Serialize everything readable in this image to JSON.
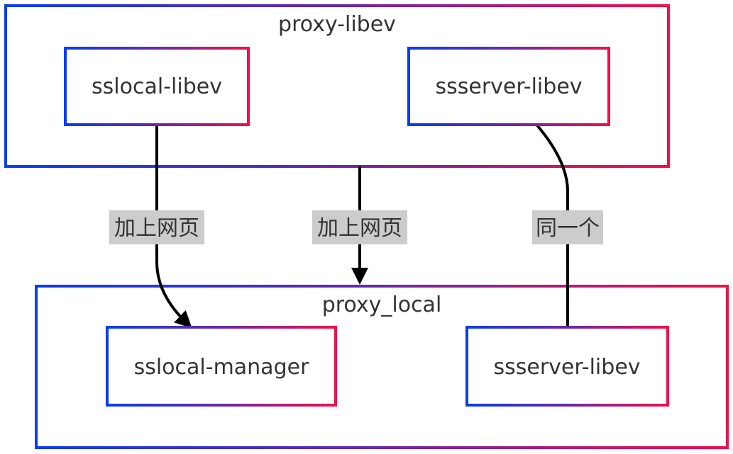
{
  "colors": {
    "gradient_start": "#0a3cf0",
    "gradient_mid": "#6a27a8",
    "gradient_end": "#f0104a",
    "text": "#333333",
    "edge": "#000000",
    "edge_label_bg": "#cccccc"
  },
  "groups": {
    "proxy_libev": {
      "title": "proxy-libev",
      "nodes": {
        "sslocal": "sslocal-libev",
        "ssserver": "ssserver-libev"
      }
    },
    "proxy_local": {
      "title": "proxy_local",
      "nodes": {
        "sslocal_manager": "sslocal-manager",
        "ssserver": "ssserver-libev"
      }
    }
  },
  "edges": [
    {
      "from": "sslocal-libev",
      "to": "sslocal-manager",
      "label": "加上网页",
      "arrow": true
    },
    {
      "from": "proxy-libev",
      "to": "proxy_local",
      "label": "加上网页",
      "arrow": true
    },
    {
      "from": "ssserver-libev",
      "to": "ssserver-libev",
      "label": "同一个",
      "arrow": false
    }
  ]
}
